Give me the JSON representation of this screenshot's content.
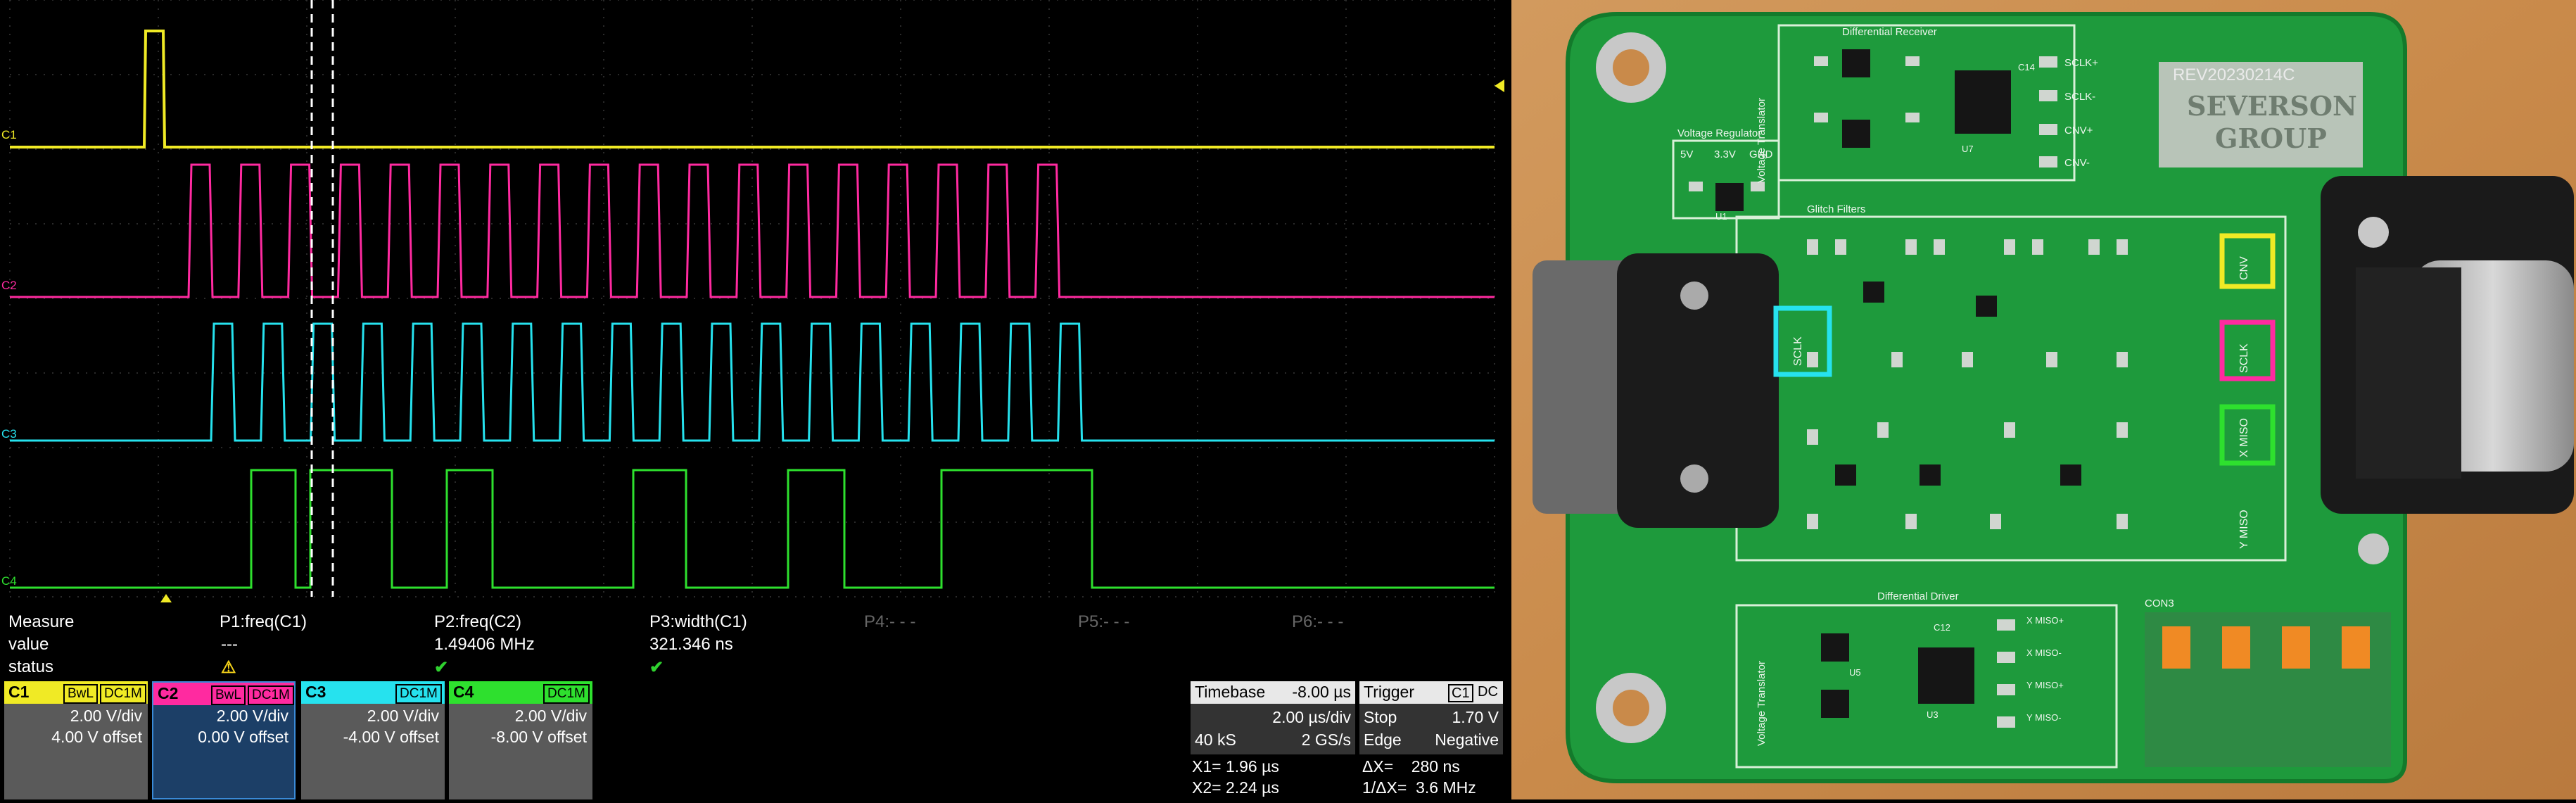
{
  "oscilloscope": {
    "channels": [
      {
        "id": "C1",
        "color": "#f0ea25",
        "scale": "2.00 V/div",
        "offset": "4.00 V offset",
        "tags": [
          "BwL",
          "DC1M"
        ]
      },
      {
        "id": "C2",
        "color": "#ff2aa0",
        "scale": "2.00 V/div",
        "offset": "0.00 V offset",
        "tags": [
          "BwL",
          "DC1M"
        ]
      },
      {
        "id": "C3",
        "color": "#26e2ee",
        "scale": "2.00 V/div",
        "offset": "-4.00 V offset",
        "tags": [
          "DC1M"
        ]
      },
      {
        "id": "C4",
        "color": "#2ee02e",
        "scale": "2.00 V/div",
        "offset": "-8.00 V offset",
        "tags": [
          "DC1M"
        ]
      }
    ],
    "measure": {
      "row_labels": {
        "measure": "Measure",
        "value": "value",
        "status": "status"
      },
      "params": [
        {
          "name": "P1:freq(C1)",
          "value": "---",
          "status": "warn"
        },
        {
          "name": "P2:freq(C2)",
          "value": "1.49406 MHz",
          "status": "ok"
        },
        {
          "name": "P3:width(C1)",
          "value": "321.346 ns",
          "status": "ok"
        },
        {
          "name": "P4:- - -",
          "value": "",
          "status": ""
        },
        {
          "name": "P5:- - -",
          "value": "",
          "status": ""
        },
        {
          "name": "P6:- - -",
          "value": "",
          "status": ""
        }
      ]
    },
    "timebase": {
      "label": "Timebase",
      "value": "-8.00 µs",
      "div": "2.00 µs/div",
      "samples": "40 kS",
      "rate": "2 GS/s"
    },
    "trigger": {
      "label": "Trigger",
      "source": "C1",
      "coupling": "DC",
      "mode": "Stop",
      "level": "1.70 V",
      "type": "Edge",
      "slope": "Negative"
    },
    "cursors": {
      "x1": "X1= 1.96 µs",
      "dx": "ΔX=    280 ns",
      "x2": "X2= 2.24 µs",
      "inv_dx": "1/ΔX=  3.6 MHz"
    }
  },
  "board": {
    "labels": {
      "diff_receiver": "Differential Receiver",
      "voltage_regulator": "Voltage Regulator",
      "voltage_translator_top": "Voltage Translator",
      "glitch_filters": "Glitch Filters",
      "rev": "REV20230214C",
      "logo_line1": "SEVERSON",
      "logo_line2": "GROUP",
      "diff_driver": "Differential Driver",
      "voltage_translator_bottom": "Voltage Translator",
      "con3": "CON3",
      "sclk_plus": "SCLK+",
      "sclk_minus": "SCLK-",
      "cnv_plus": "CNV+",
      "cnv_minus": "CNV-",
      "v5": "5V",
      "v33": "3.3V",
      "gnd": "GND",
      "cnv": "CNV",
      "sclk": "SCLK",
      "xmiso": "X MISO",
      "ymiso": "Y MISO",
      "x_miso_plus": "X MISO+",
      "x_miso_minus": "X MISO-",
      "y_miso_plus": "Y MISO+",
      "y_miso_minus": "Y MISO-",
      "u7": "U7",
      "u3": "U3",
      "u1": "U1",
      "u5": "U5",
      "c14": "C14",
      "c12": "C12"
    },
    "highlight_colors": {
      "cnv": "#f0ea25",
      "sclk": "#ff2aa0",
      "xmiso": "#2ee02e",
      "sclk_left": "#26e2ee"
    }
  }
}
